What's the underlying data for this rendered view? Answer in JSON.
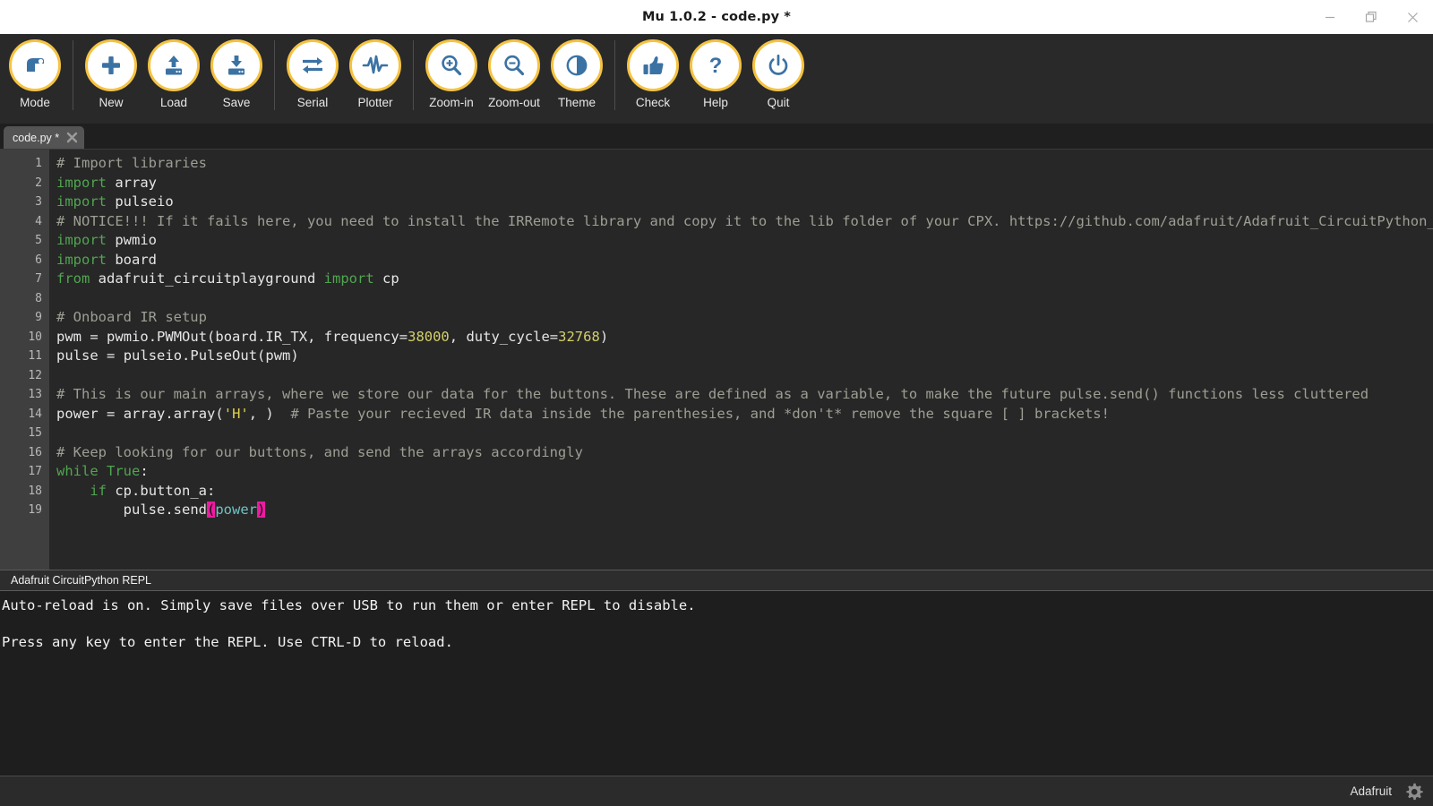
{
  "window": {
    "title": "Mu 1.0.2 - code.py *",
    "controls": [
      {
        "name": "minimize",
        "glyph": "minimize-icon"
      },
      {
        "name": "restore",
        "glyph": "restore-icon"
      },
      {
        "name": "close",
        "glyph": "close-icon"
      }
    ]
  },
  "toolbar": {
    "groups": [
      {
        "items": [
          {
            "label": "Mode",
            "icon": "mode-icon"
          }
        ]
      },
      {
        "items": [
          {
            "label": "New",
            "icon": "plus-icon"
          },
          {
            "label": "Load",
            "icon": "upload-icon"
          },
          {
            "label": "Save",
            "icon": "download-icon"
          }
        ]
      },
      {
        "items": [
          {
            "label": "Serial",
            "icon": "exchange-arrows-icon"
          },
          {
            "label": "Plotter",
            "icon": "waveform-icon"
          }
        ]
      },
      {
        "items": [
          {
            "label": "Zoom-in",
            "icon": "magnifier-plus-icon"
          },
          {
            "label": "Zoom-out",
            "icon": "magnifier-minus-icon"
          },
          {
            "label": "Theme",
            "icon": "contrast-circle-icon"
          }
        ]
      },
      {
        "items": [
          {
            "label": "Check",
            "icon": "thumbs-up-icon"
          },
          {
            "label": "Help",
            "icon": "question-mark-icon"
          },
          {
            "label": "Quit",
            "icon": "power-icon"
          }
        ]
      }
    ]
  },
  "tabs": [
    {
      "label": "code.py *",
      "close_icon": "close-icon",
      "active": true
    }
  ],
  "editor": {
    "first_line": 1,
    "line_count": 19,
    "lines": [
      {
        "n": 1,
        "text": "# Import libraries"
      },
      {
        "n": 2,
        "text": "import array"
      },
      {
        "n": 3,
        "text": "import pulseio"
      },
      {
        "n": 4,
        "text": "# NOTICE!!! If it fails here, you need to install the IRRemote library and copy it to the lib folder of your CPX. https://github.com/adafruit/Adafruit_CircuitPython_IRRemote"
      },
      {
        "n": 5,
        "text": "import pwmio"
      },
      {
        "n": 6,
        "text": "import board"
      },
      {
        "n": 7,
        "text": "from adafruit_circuitplayground import cp"
      },
      {
        "n": 8,
        "text": ""
      },
      {
        "n": 9,
        "text": "# Onboard IR setup"
      },
      {
        "n": 10,
        "text": "pwm = pwmio.PWMOut(board.IR_TX, frequency=38000, duty_cycle=32768)"
      },
      {
        "n": 11,
        "text": "pulse = pulseio.PulseOut(pwm)"
      },
      {
        "n": 12,
        "text": ""
      },
      {
        "n": 13,
        "text": "# This is our main arrays, where we store our data for the buttons. These are defined as a variable, to make the future pulse.send() functions less cluttered"
      },
      {
        "n": 14,
        "text": "power = array.array('H', )  # Paste your recieved IR data inside the parenthesies, and *don't* remove the square [ ] brackets!"
      },
      {
        "n": 15,
        "text": ""
      },
      {
        "n": 16,
        "text": "# Keep looking for our buttons, and send the arrays accordingly"
      },
      {
        "n": 17,
        "text": "while True:"
      },
      {
        "n": 18,
        "text": "    if cp.button_a:"
      },
      {
        "n": 19,
        "text": "        pulse.send(power)"
      }
    ]
  },
  "repl": {
    "title": "Adafruit CircuitPython REPL",
    "lines": [
      "Auto-reload is on. Simply save files over USB to run them or enter REPL to disable.",
      "",
      "Press any key to enter the REPL. Use CTRL-D to reload."
    ]
  },
  "statusbar": {
    "mode": "Adafruit",
    "gear_icon": "gear-icon"
  },
  "colors": {
    "accent": "#f5c342",
    "icon_blue": "#3b72a4",
    "comment": "#9e9e95",
    "keyword": "#51a551",
    "number": "#d4cf6a",
    "string": "#e0d24e",
    "bracket_match": "#ec1ba0",
    "editor_bg": "#272727",
    "gutter_bg": "#3f3f3f",
    "repl_bg": "#1e1e1e"
  }
}
